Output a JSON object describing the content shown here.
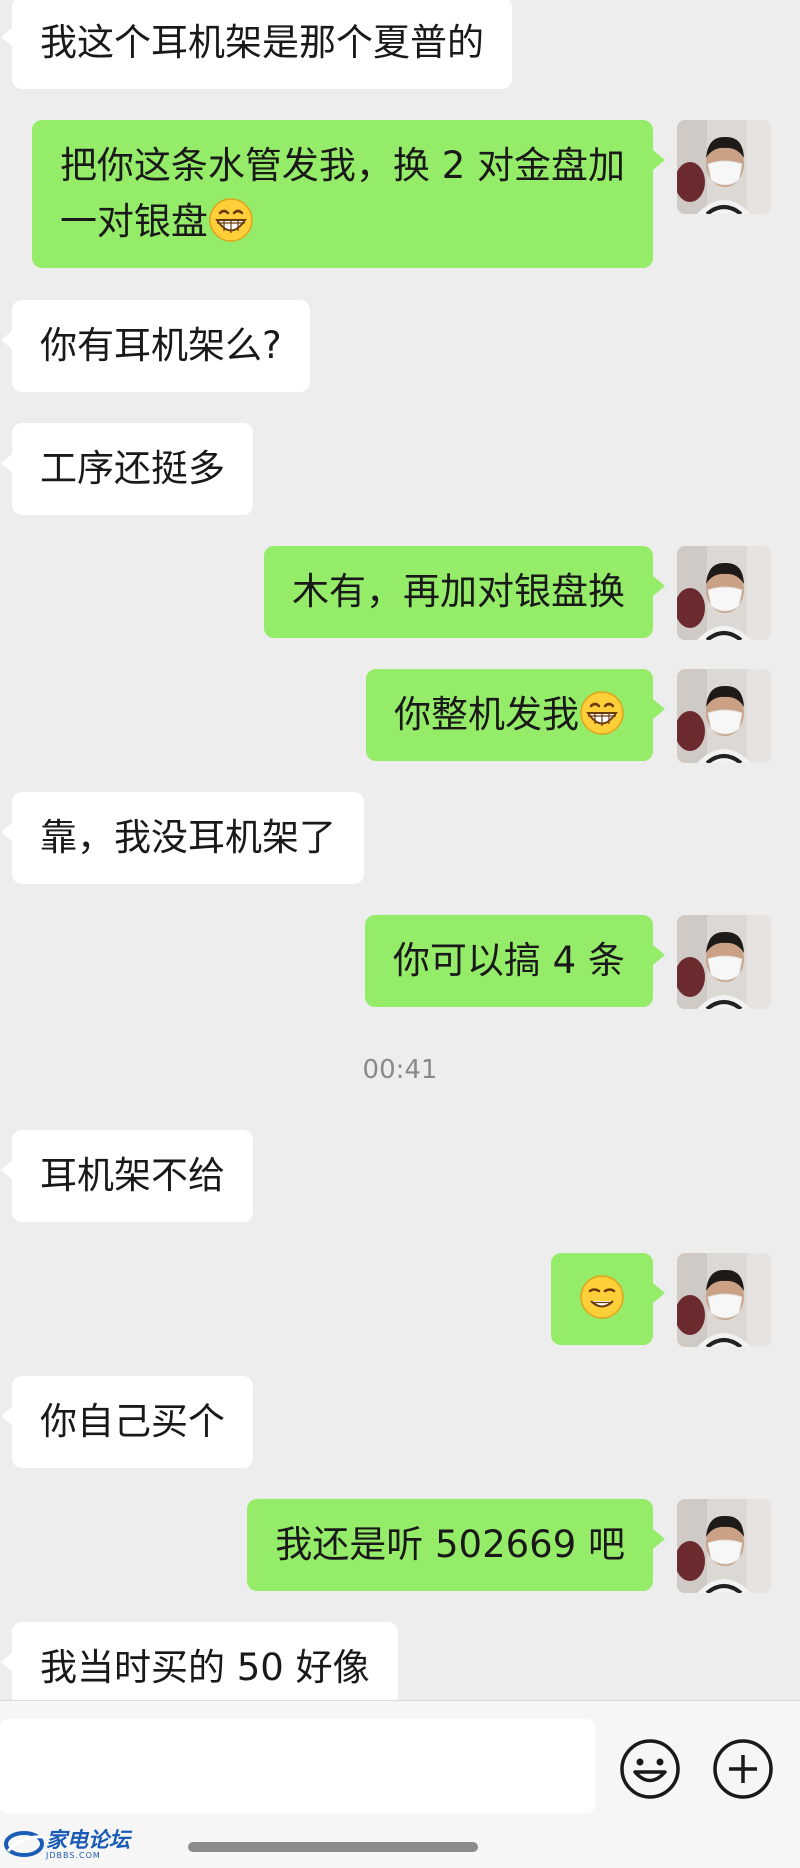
{
  "messages": [
    {
      "side": "in",
      "text": "我这个耳机架是那个夏普的"
    },
    {
      "side": "out",
      "text": "把你这条水管发我，换 2 对金盘加\n一对银盘",
      "emoji": "grin"
    },
    {
      "side": "in",
      "text": "你有耳机架么?"
    },
    {
      "side": "in",
      "text": "工序还挺多"
    },
    {
      "side": "out",
      "text": "木有，再加对银盘换"
    },
    {
      "side": "out",
      "text": "你整机发我",
      "emoji": "grin"
    },
    {
      "side": "in",
      "text": "靠，我没耳机架了"
    },
    {
      "side": "out",
      "text": "你可以搞 4 条"
    },
    {
      "timestamp": "00:41"
    },
    {
      "side": "in",
      "text": "耳机架不给"
    },
    {
      "side": "out",
      "text": "",
      "emoji": "smirk"
    },
    {
      "side": "in",
      "text": "你自己买个"
    },
    {
      "side": "out",
      "text": "我还是听 502669 吧"
    },
    {
      "side": "in",
      "text": "我当时买的 50 好像"
    }
  ],
  "input_bar": {
    "message_value": "",
    "emoji_button_icon": "smiley-face-icon",
    "more_button_icon": "plus-circle-icon"
  },
  "watermark": {
    "text": "家电论坛",
    "subtext": "JDBBS.COM"
  },
  "colors": {
    "background": "#ededed",
    "incoming_bubble": "#ffffff",
    "outgoing_bubble": "#95ec69",
    "text": "#191919",
    "timestamp": "#8a8a8a"
  }
}
